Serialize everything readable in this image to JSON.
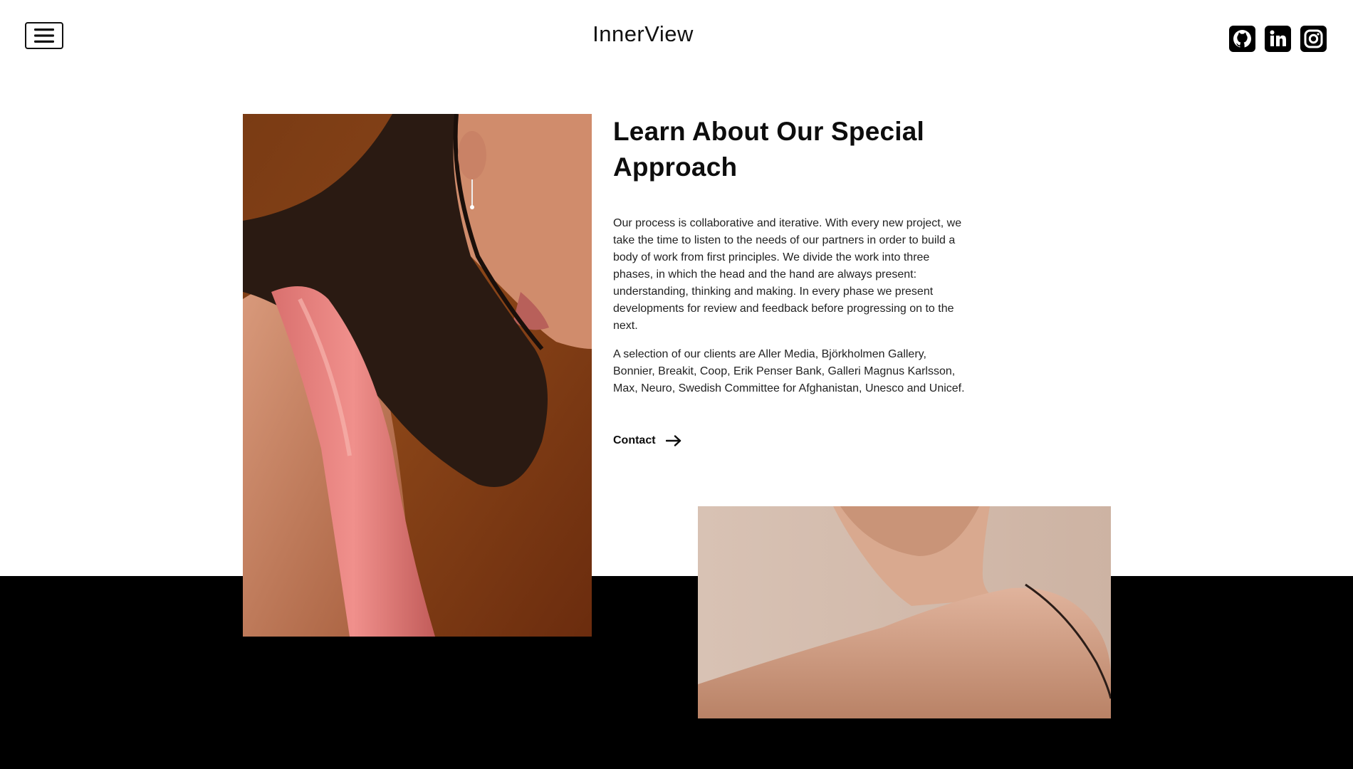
{
  "header": {
    "brand": "InnerView",
    "menu_icon": "hamburger-menu-icon",
    "social": [
      {
        "icon": "github-icon"
      },
      {
        "icon": "linkedin-icon"
      },
      {
        "icon": "instagram-icon"
      }
    ]
  },
  "about": {
    "heading_line1": "Learn About Our Special",
    "heading_line2": "Approach",
    "paragraph_1": "Our process is collaborative and iterative. With every new project, we take the time to listen to the needs of our partners in order to build a body of work from first principles. We divide the work into three phases, in which the head and the hand are always present: understanding, thinking and making. In every phase we present developments for review and feedback before progressing on to the next.",
    "paragraph_2": "A selection of our clients are Aller Media, Björkholmen Gallery, Bonnier, Breakit, Coop, Erik Penser Bank, Galleri Magnus Karlsson, Max, Neuro, Swedish Committee for Afghanistan, Unesco and Unicef.",
    "contact_label": "Contact",
    "contact_icon": "arrow-right-icon"
  },
  "colors": {
    "background": "#ffffff",
    "band": "#000000",
    "text": "#111111"
  }
}
